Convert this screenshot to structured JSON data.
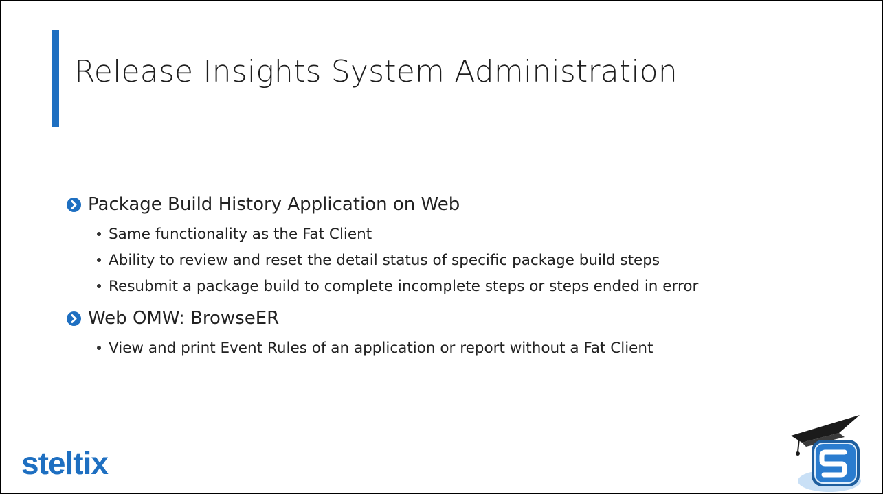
{
  "title": "Release Insights System Administration",
  "sections": [
    {
      "heading": "Package Build History Application on Web",
      "bullets": [
        "Same functionality as the Fat Client",
        "Ability to review and reset the detail status of specific package build steps",
        "Resubmit a package build to complete incomplete steps or steps ended in error"
      ]
    },
    {
      "heading": "Web OMW: BrowseER",
      "bullets": [
        "View and print Event Rules of an application or report without a Fat Client"
      ]
    }
  ],
  "logo": {
    "text": "steltix"
  },
  "icons": {
    "section_bullet": "chevron-circle-right-icon",
    "corner": "graduation-cap-s-icon"
  },
  "colors": {
    "accent": "#1e6fc1",
    "logo": "#1e6fc1",
    "text": "#1e1e1e"
  }
}
